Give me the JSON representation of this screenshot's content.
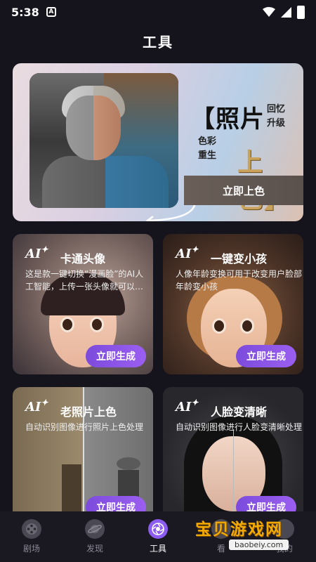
{
  "status_bar": {
    "time": "5:38",
    "notif_letter": "A"
  },
  "page_title": "工具",
  "hero": {
    "title": "【照片",
    "sub_top": [
      "回忆",
      "升级"
    ],
    "sub_left": [
      "色彩",
      "重生"
    ],
    "color_text": "上色】",
    "button": "立即上色"
  },
  "cards": [
    {
      "ai": "AI",
      "title": "卡通头像",
      "desc": "这是款一键切换“漫画脸”的AI人工智能，上传一张头像就可以…",
      "button": "立即生成"
    },
    {
      "ai": "AI",
      "title": "一键变小孩",
      "desc": "人像年龄变换可用于改变用户脸部年龄变小孩",
      "button": "立即生成"
    },
    {
      "ai": "AI",
      "title": "老照片上色",
      "desc": "自动识别图像进行照片上色处理",
      "button": "立即生成"
    },
    {
      "ai": "AI",
      "title": "人脸变清晰",
      "desc": "自动识别图像进行人脸变清晰处理",
      "button": "立即生成"
    }
  ],
  "nav": [
    {
      "label": "剧场",
      "icon": "film-reel-icon"
    },
    {
      "label": "发现",
      "icon": "planet-icon"
    },
    {
      "label": "工具",
      "icon": "aperture-icon",
      "active": true
    },
    {
      "label": "看",
      "icon": "eye-icon"
    },
    {
      "label": "我的",
      "icon": "profile-icon"
    }
  ],
  "watermark": {
    "text": "宝贝游戏网",
    "url": "baobeiy.com"
  },
  "colors": {
    "background": "#15141c",
    "accent": "#8c5cf0",
    "gold": "#c9a25c"
  }
}
